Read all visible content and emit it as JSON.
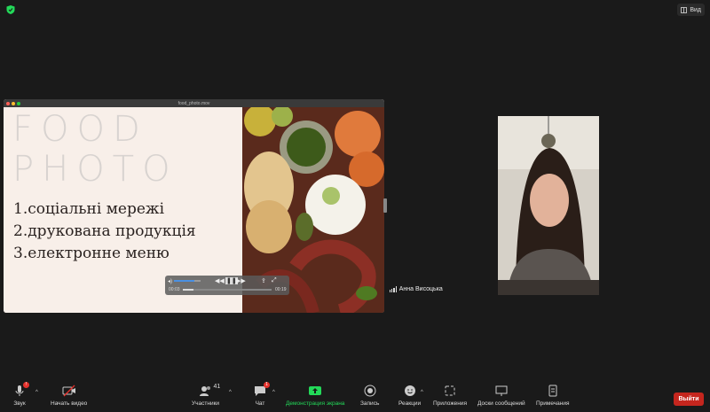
{
  "top": {
    "view_label": "Вид"
  },
  "share": {
    "window_title": "food_photo.mov",
    "slide": {
      "title_line1": "FOOD",
      "title_line2": "PHOTO",
      "items": [
        "1.соціальні мережі",
        "2.друкована продукція",
        "3.електронне меню"
      ]
    },
    "media": {
      "time_start": "00:03",
      "time_end": "00:19",
      "volume": 0.75,
      "progress": 0.12
    }
  },
  "participant": {
    "name": "Анна Висоцька"
  },
  "toolbar": {
    "mic_label": "Звук",
    "mic_badge": "!",
    "video_label": "Начать видео",
    "participants_label": "Участники",
    "participants_count": "41",
    "chat_label": "Чат",
    "chat_badge": "1",
    "share_label": "Демонстрация экрана",
    "record_label": "Запись",
    "reactions_label": "Реакции",
    "apps_label": "Приложения",
    "whiteboard_label": "Доски сообщений",
    "notes_label": "Примечания",
    "leave_label": "Выйти"
  },
  "colors": {
    "accent_green": "#23d959",
    "leave_red": "#c5261e",
    "badge_red": "#e5322d"
  }
}
